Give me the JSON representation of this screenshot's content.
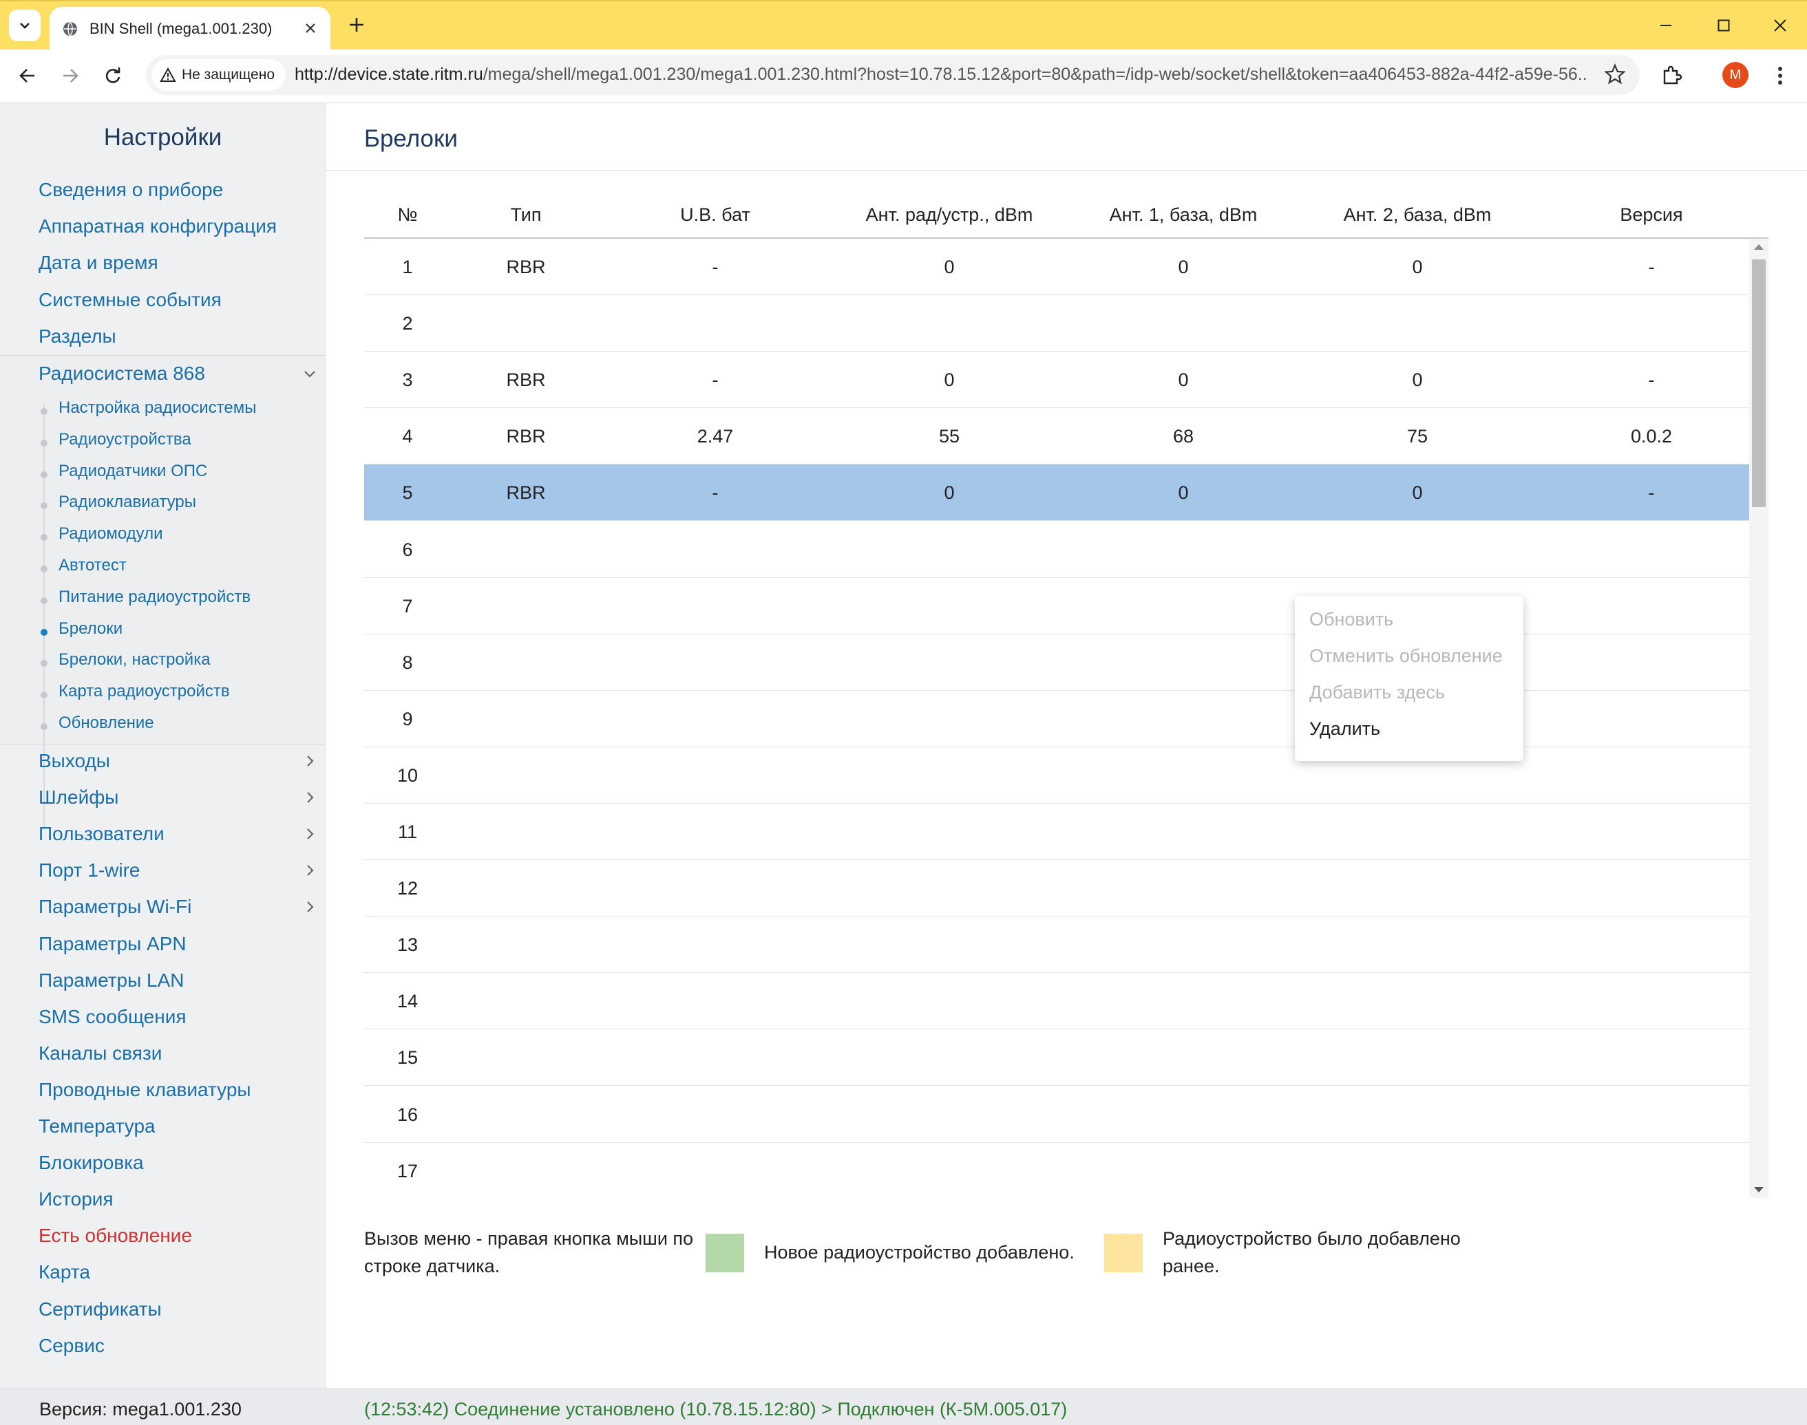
{
  "browser": {
    "tab_title": "BIN Shell (mega1.001.230)",
    "security_label": "Не защищено",
    "url_host": "http://device.state.ritm.ru",
    "url_path": "/mega/shell/mega1.001.230/mega1.001.230.html?host=10.78.15.12&port=80&path=/idp-web/socket/shell&token=aa406453-882a-44f2-a59e-56...",
    "profile_initial": "M",
    "icons": [
      "tab-list-icon",
      "globe-icon",
      "close-icon",
      "plus-icon",
      "minimize-icon",
      "maximize-icon",
      "window-close-icon",
      "back-icon",
      "forward-icon",
      "reload-icon",
      "warning-icon",
      "star-icon",
      "extensions-icon",
      "more-icon"
    ]
  },
  "sidebar": {
    "title": "Настройки",
    "top_items": [
      {
        "label": "Сведения о приборе"
      },
      {
        "label": "Аппаратная конфигурация"
      },
      {
        "label": "Дата и время"
      },
      {
        "label": "Системные события"
      },
      {
        "label": "Разделы"
      }
    ],
    "group": {
      "label": "Радиосистема 868",
      "expanded": true,
      "children": [
        {
          "label": "Настройка радиосистемы",
          "active": false
        },
        {
          "label": "Радиоустройства",
          "active": false
        },
        {
          "label": "Радиодатчики ОПС",
          "active": false
        },
        {
          "label": "Радиоклавиатуры",
          "active": false
        },
        {
          "label": "Радиомодули",
          "active": false
        },
        {
          "label": "Автотест",
          "active": false
        },
        {
          "label": "Питание радиоустройств",
          "active": false
        },
        {
          "label": "Брелоки",
          "active": true
        },
        {
          "label": "Брелоки, настройка",
          "active": false
        },
        {
          "label": "Карта радиоустройств",
          "active": false
        },
        {
          "label": "Обновление",
          "active": false
        }
      ]
    },
    "bottom_items": [
      {
        "label": "Выходы",
        "has_children": true
      },
      {
        "label": "Шлейфы",
        "has_children": true
      },
      {
        "label": "Пользователи",
        "has_children": true
      },
      {
        "label": "Порт 1-wire",
        "has_children": true
      },
      {
        "label": "Параметры Wi-Fi",
        "has_children": true
      },
      {
        "label": "Параметры APN",
        "has_children": false
      },
      {
        "label": "Параметры LAN",
        "has_children": false
      },
      {
        "label": "SMS сообщения",
        "has_children": false
      },
      {
        "label": "Каналы связи",
        "has_children": false
      },
      {
        "label": "Проводные клавиатуры",
        "has_children": false
      },
      {
        "label": "Температура",
        "has_children": false
      },
      {
        "label": "Блокировка",
        "has_children": false
      },
      {
        "label": "История",
        "has_children": false
      },
      {
        "label": "Есть обновление",
        "has_children": false,
        "highlight": "#d32f2f"
      },
      {
        "label": "Карта",
        "has_children": false
      },
      {
        "label": "Сертификаты",
        "has_children": false
      },
      {
        "label": "Сервис",
        "has_children": false
      }
    ],
    "version": "Версия: mega1.001.230"
  },
  "main": {
    "title": "Брелоки",
    "table": {
      "columns": [
        "№",
        "Тип",
        "U.В. бат",
        "Ант. рад/устр., dBm",
        "Ант. 1, база, dBm",
        "Ант. 2, база, dBm",
        "Версия"
      ],
      "rows": [
        [
          "1",
          "RBR",
          "-",
          "0",
          "0",
          "0",
          "-"
        ],
        [
          "2",
          "",
          "",
          "",
          "",
          "",
          ""
        ],
        [
          "3",
          "RBR",
          "-",
          "0",
          "0",
          "0",
          "-"
        ],
        [
          "4",
          "RBR",
          "2.47",
          "55",
          "68",
          "75",
          "0.0.2"
        ],
        [
          "5",
          "RBR",
          "-",
          "0",
          "0",
          "0",
          "-"
        ],
        [
          "6",
          "",
          "",
          "",
          "",
          "",
          ""
        ],
        [
          "7",
          "",
          "",
          "",
          "",
          "",
          ""
        ],
        [
          "8",
          "",
          "",
          "",
          "",
          "",
          ""
        ],
        [
          "9",
          "",
          "",
          "",
          "",
          "",
          ""
        ],
        [
          "10",
          "",
          "",
          "",
          "",
          "",
          ""
        ],
        [
          "11",
          "",
          "",
          "",
          "",
          "",
          ""
        ],
        [
          "12",
          "",
          "",
          "",
          "",
          "",
          ""
        ],
        [
          "13",
          "",
          "",
          "",
          "",
          "",
          ""
        ],
        [
          "14",
          "",
          "",
          "",
          "",
          "",
          ""
        ],
        [
          "15",
          "",
          "",
          "",
          "",
          "",
          ""
        ],
        [
          "16",
          "",
          "",
          "",
          "",
          "",
          ""
        ],
        [
          "17",
          "",
          "",
          "",
          "",
          "",
          ""
        ]
      ],
      "selected_row": 5
    },
    "context_menu": [
      {
        "label": "Обновить",
        "enabled": false
      },
      {
        "label": "Отменить обновление",
        "enabled": false
      },
      {
        "label": "Добавить здесь",
        "enabled": false
      },
      {
        "label": "Удалить",
        "enabled": true
      }
    ],
    "legend": {
      "hint": "Вызов меню - правая кнопка мыши по строке датчика.",
      "new_label": "Новое радиоустройство добавлено.",
      "new_color": "#b5d8a9",
      "old_label": "Радиоустройство было добавлено ранее.",
      "old_color": "#fde49e"
    }
  },
  "status": {
    "text": "(12:53:42) Соединение установлено (10.78.15.12:80) > Подключен (К-5М.005.017)",
    "color": "#2e7d32"
  },
  "colors": {
    "tabbar": "#fddf63",
    "accent": "#1a6fa8",
    "selected_row": "#a3c6e9",
    "title": "#1e3a5f"
  }
}
